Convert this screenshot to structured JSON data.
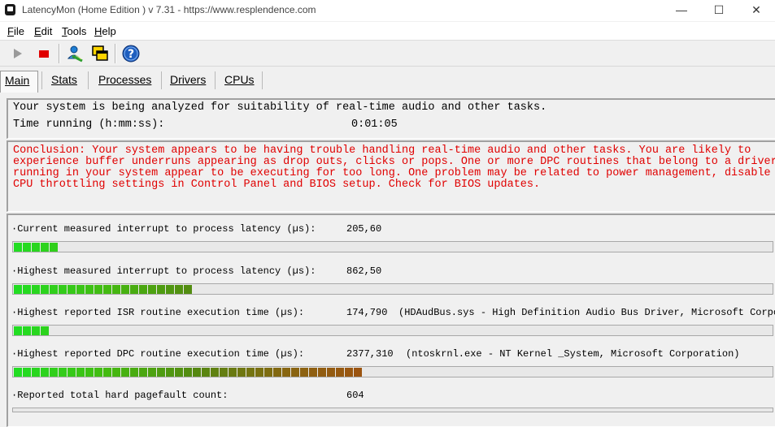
{
  "window": {
    "title": "LatencyMon  (Home Edition )  v 7.31 - https://www.resplendence.com",
    "minimize": "—",
    "maximize": "☐",
    "close": "✕"
  },
  "menu": {
    "items": [
      {
        "u": "F",
        "rest": "ile"
      },
      {
        "u": "E",
        "rest": "dit"
      },
      {
        "u": "T",
        "rest": "ools"
      },
      {
        "u": "H",
        "rest": "elp"
      }
    ]
  },
  "toolbar": {
    "icons": [
      "play-icon",
      "stop-icon",
      "user-admin-icon",
      "window-icon",
      "help-icon"
    ],
    "colors": {
      "play": "#9a9a9a",
      "stop": "#e00000",
      "help": "#1f5fbf"
    }
  },
  "tabs": [
    "Main",
    "Stats",
    "Processes",
    "Drivers",
    "CPUs"
  ],
  "summary": {
    "line1": "Your system is being analyzed for suitability of real-time audio and other tasks.",
    "time_label": "Time running (h:mm:ss):",
    "time_value": "0:01:05"
  },
  "conclusion": {
    "lines": [
      "Conclusion: Your system appears to be having trouble handling real-time audio and other tasks. You are likely to",
      "experience buffer underruns appearing as drop outs, clicks or pops. One or more DPC routines that belong to a driver",
      "running in your system appear to be executing for too long. One problem may be related to power management, disable",
      "CPU throttling settings in Control Panel and BIOS setup. Check for BIOS updates."
    ],
    "color": "#e00000"
  },
  "stats": [
    {
      "label": "·Current measured interrupt to process latency (µs):",
      "value": "205,60",
      "extra": "",
      "segments": 5
    },
    {
      "label": "·Highest measured interrupt to process latency (µs):",
      "value": "862,50",
      "extra": "",
      "segments": 20
    },
    {
      "label": "·Highest reported ISR routine execution time (µs):",
      "value": "174,790",
      "extra": "(HDAudBus.sys - High Definition Audio Bus Driver, Microsoft Corpor",
      "segments": 4
    },
    {
      "label": "·Highest reported DPC routine execution time (µs):",
      "value": "2377,310",
      "extra": "(ntoskrnl.exe - NT Kernel _System, Microsoft Corporation)",
      "segments": 39
    },
    {
      "label": "·Reported total hard pagefault count:",
      "value": "604",
      "extra": "",
      "segments": 0
    }
  ]
}
